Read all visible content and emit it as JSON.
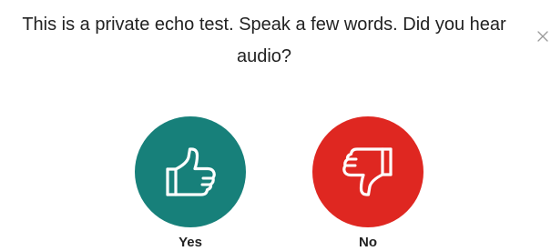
{
  "dialog": {
    "prompt": "This is a private echo test. Speak a few words. Did you hear audio?",
    "close_icon": "close-icon"
  },
  "choices": {
    "yes": {
      "label": "Yes",
      "icon": "thumbs-up-icon",
      "color": "#17807a"
    },
    "no": {
      "label": "No",
      "icon": "thumbs-down-icon",
      "color": "#df2721"
    }
  }
}
